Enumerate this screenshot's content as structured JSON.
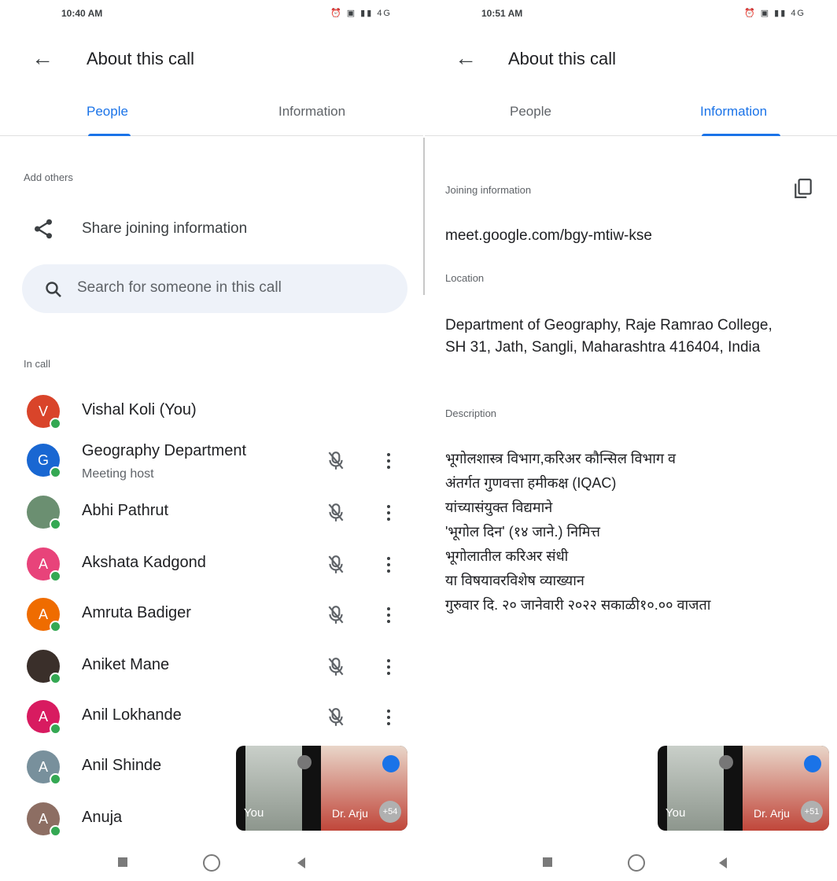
{
  "left": {
    "status": {
      "time": "10:40 AM",
      "icons": "⏰ ▣ ▮▮ 4G"
    },
    "title": "About this call",
    "tabs": [
      "People",
      "Information"
    ],
    "add_others_label": "Add others",
    "share_label": "Share joining information",
    "search_placeholder": "Search for someone in this call",
    "in_call_label": "In call",
    "people": [
      {
        "name": "Vishal Koli (You)",
        "initial": "V",
        "color": "#d9442a"
      },
      {
        "name": "Geography Department",
        "sub": "Meeting host",
        "initial": "G",
        "color": "#1967d2"
      },
      {
        "name": "Abhi Pathrut",
        "initial": "",
        "color": "#6b8f71"
      },
      {
        "name": "Akshata Kadgond",
        "initial": "A",
        "color": "#e8437a"
      },
      {
        "name": "Amruta Badiger",
        "initial": "A",
        "color": "#ef6c00"
      },
      {
        "name": "Aniket Mane",
        "initial": "",
        "color": "#3a2f2a"
      },
      {
        "name": "Anil Lokhande",
        "initial": "A",
        "color": "#d81b60"
      },
      {
        "name": "Anil Shinde",
        "initial": "A",
        "color": "#78909c"
      },
      {
        "name": "Anuja",
        "initial": "A",
        "color": "#8d6e63"
      }
    ],
    "pip": {
      "you": "You",
      "other": "Dr. Arju",
      "count": "+54"
    }
  },
  "right": {
    "status": {
      "time": "10:51 AM",
      "icons": "⏰ ▣ ▮▮ 4G"
    },
    "title": "About this call",
    "tabs": [
      "People",
      "Information"
    ],
    "joining_label": "Joining information",
    "link": "meet.google.com/bgy-mtiw-kse",
    "location_label": "Location",
    "location": "Department of Geography, Raje Ramrao College, SH 31, Jath, Sangli, Maharashtra 416404, India",
    "description_label": "Description",
    "description": "भूगोलशास्त्र विभाग,करिअर कौन्सिल विभाग व\nअंतर्गत गुणवत्ता हमीकक्ष (IQAC)\nयांच्यासंयुक्त विद्यमाने\n'भूगोल दिन' (१४ जाने.) निमित्त\nभूगोलातील करिअर संधी\nया विषयावरविशेष व्याख्यान\nगुरुवार दि. २० जानेवारी २०२२ सकाळी१०.०० वाजता",
    "pip": {
      "you": "You",
      "other": "Dr. Arju",
      "count": "+51"
    }
  }
}
